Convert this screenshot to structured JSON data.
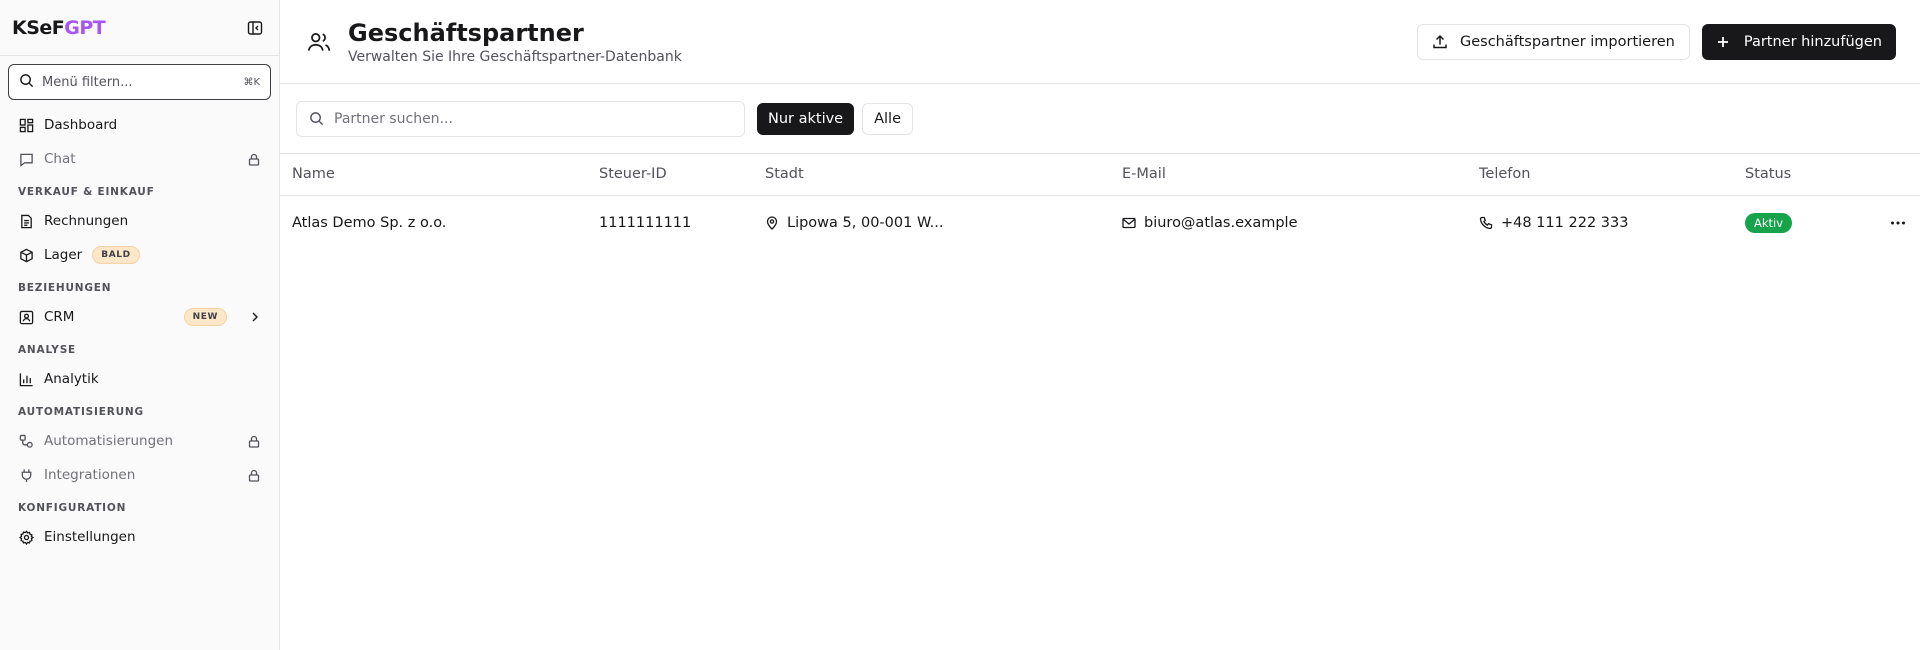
{
  "app": {
    "logo_part1": "KSeF",
    "logo_part2": "GPT"
  },
  "sidebar": {
    "filter_placeholder": "Menü filtern...",
    "filter_shortcut": "⌘K",
    "items_top": [
      {
        "label": "Dashboard"
      },
      {
        "label": "Chat",
        "locked": true
      }
    ],
    "sections": [
      {
        "title": "VERKAUF & EINKAUF",
        "items": [
          {
            "label": "Rechnungen"
          },
          {
            "label": "Lager",
            "badge": "BALD"
          }
        ]
      },
      {
        "title": "BEZIEHUNGEN",
        "items": [
          {
            "label": "CRM",
            "badge": "NEW"
          }
        ]
      },
      {
        "title": "ANALYSE",
        "items": [
          {
            "label": "Analytik"
          }
        ]
      },
      {
        "title": "AUTOMATISIERUNG",
        "items": [
          {
            "label": "Automatisierungen"
          },
          {
            "label": "Integrationen"
          }
        ]
      },
      {
        "title": "KONFIGURATION",
        "items": [
          {
            "label": "Einstellungen"
          }
        ]
      }
    ]
  },
  "page": {
    "title": "Geschäftspartner",
    "subtitle": "Verwalten Sie Ihre Geschäftspartner-Datenbank",
    "import_label": "Geschäftspartner importieren",
    "add_label": "Partner hinzufügen"
  },
  "toolbar": {
    "search_placeholder": "Partner suchen...",
    "filter_active": "Nur aktive",
    "filter_all": "Alle"
  },
  "table": {
    "columns": [
      "Name",
      "Steuer-ID",
      "Stadt",
      "E-Mail",
      "Telefon",
      "Status"
    ],
    "rows": [
      {
        "name": "Atlas Demo Sp. z o.o.",
        "tax_id": "1111111111",
        "city": "Lipowa 5, 00-001 W...",
        "email": "biuro@atlas.example",
        "phone": "+48 111 222 333",
        "status": "Aktiv"
      }
    ]
  },
  "colors": {
    "accent": "#a855f7",
    "dark": "#18181b",
    "status_active": "#16a34a",
    "badge_bg": "#fde7c9"
  }
}
